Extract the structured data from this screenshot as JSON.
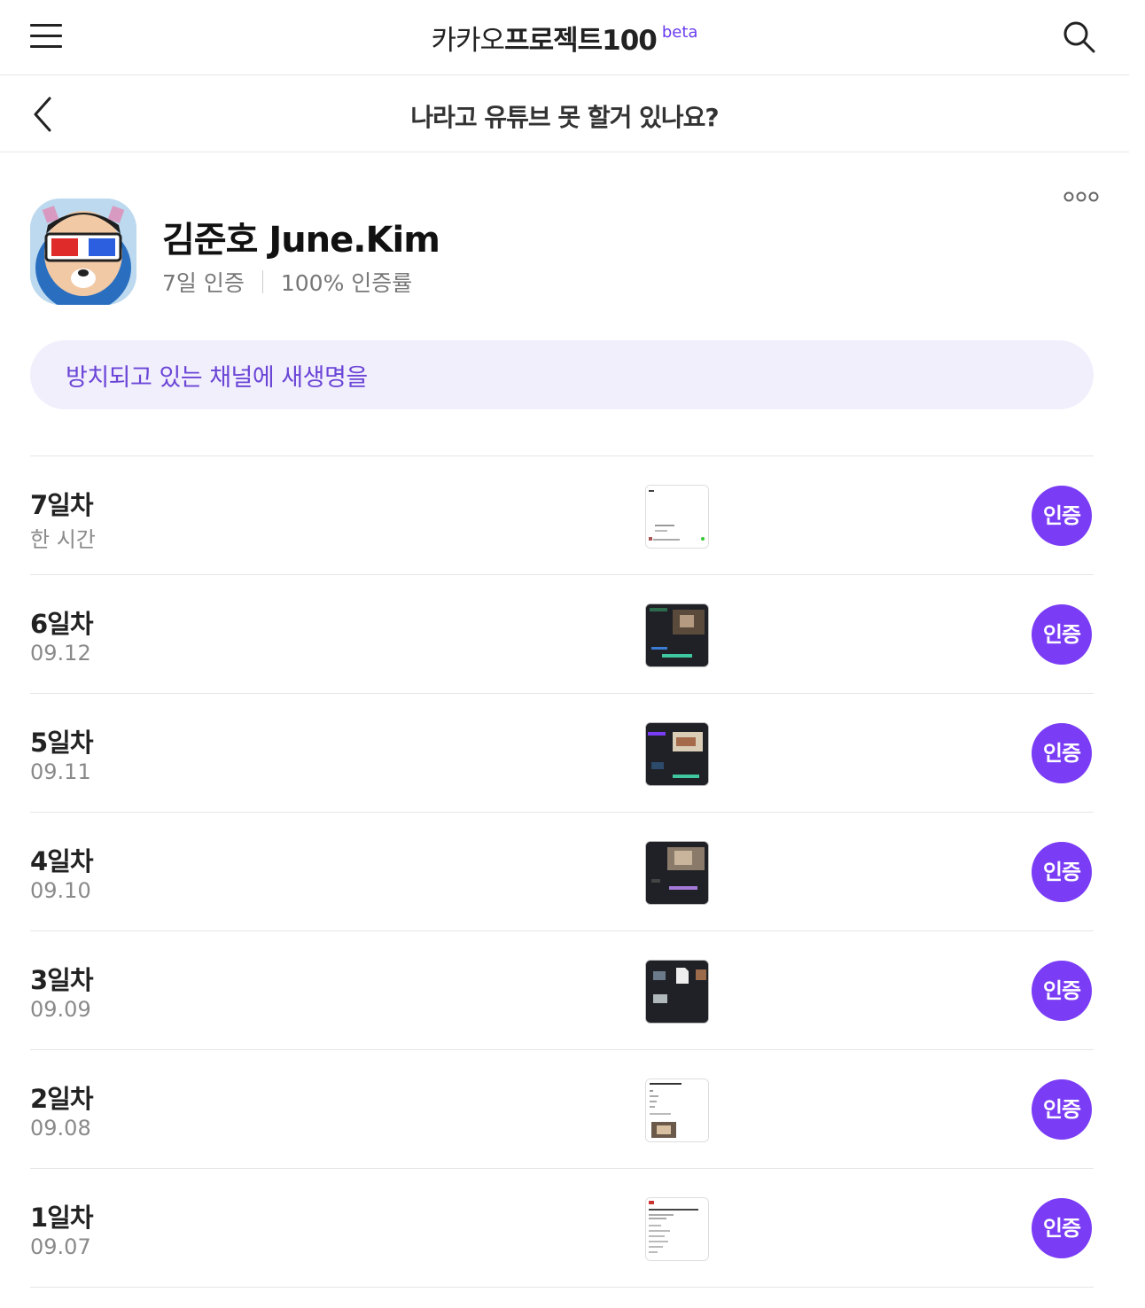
{
  "header": {
    "logo_light": "카카오",
    "logo_bold": "프로젝트100",
    "logo_beta": "beta",
    "menu_icon": "hamburger-menu-icon",
    "search_icon": "search-icon"
  },
  "subheader": {
    "title": "나라고 유튜브 못 할거 있나요?",
    "back_icon": "chevron-left-icon"
  },
  "profile": {
    "name": "김준호 June.Kim",
    "days_certified": "7일 인증",
    "rate": "100% 인증률",
    "more_icon": "more-dots-icon"
  },
  "goal": {
    "text": "방치되고 있는 채널에 새생명을"
  },
  "entries": [
    {
      "day": "7일차",
      "date": "한 시간",
      "badge": "인증"
    },
    {
      "day": "6일차",
      "date": "09.12",
      "badge": "인증"
    },
    {
      "day": "5일차",
      "date": "09.11",
      "badge": "인증"
    },
    {
      "day": "4일차",
      "date": "09.10",
      "badge": "인증"
    },
    {
      "day": "3일차",
      "date": "09.09",
      "badge": "인증"
    },
    {
      "day": "2일차",
      "date": "09.08",
      "badge": "인증"
    },
    {
      "day": "1일차",
      "date": "09.07",
      "badge": "인증"
    }
  ],
  "colors": {
    "accent": "#7a3cf5",
    "goal_bg": "#f2effd",
    "goal_text": "#6a45d6"
  }
}
